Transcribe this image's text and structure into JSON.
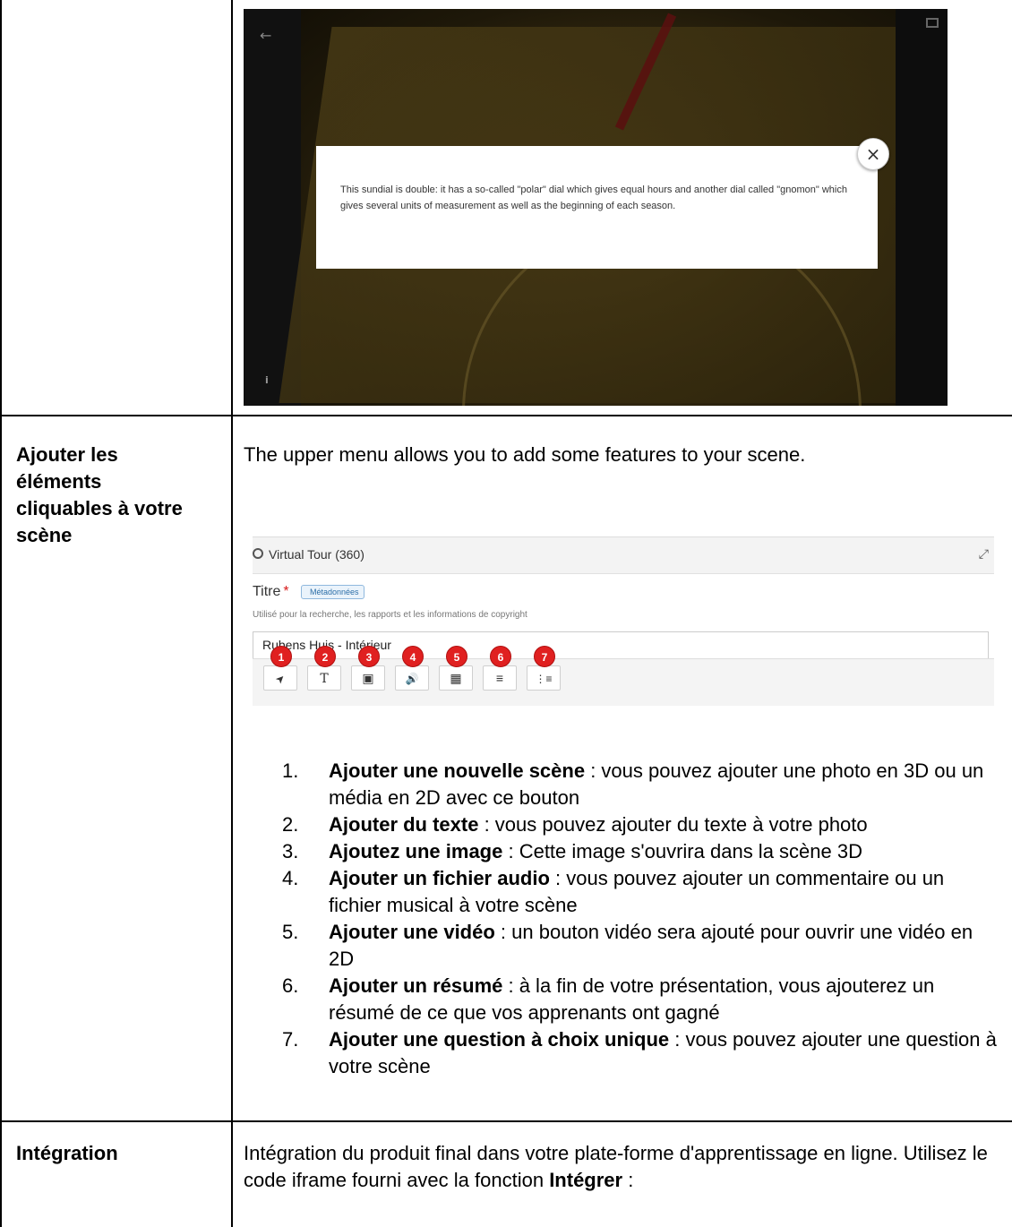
{
  "viewer": {
    "popup_text": "This sundial is double: it has a so-called \"polar\" dial which gives equal hours and another dial called \"gnomon\" which gives several units of measurement as well as the beginning of each season.",
    "close_glyph": "×",
    "back_glyph": "←",
    "info_glyph": "i"
  },
  "rows": [
    {
      "label": "Ajouter les éléments cliquables à votre scène",
      "label_lines": [
        "Ajouter les",
        "éléments",
        "cliquables à votre",
        "scène"
      ],
      "intro": "The upper menu allows you to add some features to your scene."
    },
    {
      "label": "Intégration",
      "text_prefix": "Intégration du produit final dans votre plate-forme d'apprentissage en ligne.  Utilisez le code iframe fourni avec la fonction ",
      "text_bold": "Intégrer",
      "text_suffix": " :"
    }
  ],
  "editor": {
    "header_title": "Virtual Tour (360)",
    "field_label": "Titre",
    "required_mark": "*",
    "meta_tag": "Métadonnées",
    "help_text": "Utilisé pour la recherche, les rapports et les informations de copyright",
    "input_value": "Rubens Huis - Intérieur",
    "toolbar": [
      {
        "badge": "1",
        "icon": "navigation-arrow-icon",
        "glyph": "➤"
      },
      {
        "badge": "2",
        "icon": "text-icon",
        "glyph": "T"
      },
      {
        "badge": "3",
        "icon": "image-icon",
        "glyph": "▣"
      },
      {
        "badge": "4",
        "icon": "audio-icon",
        "glyph": "🔊"
      },
      {
        "badge": "5",
        "icon": "video-icon",
        "glyph": "▦"
      },
      {
        "badge": "6",
        "icon": "summary-list-icon",
        "glyph": "≡"
      },
      {
        "badge": "7",
        "icon": "numbered-list-icon",
        "glyph": "⋮≡"
      }
    ]
  },
  "list": [
    {
      "n": "1.",
      "bold": "Ajouter une nouvelle scène",
      "rest": " : vous pouvez ajouter une photo en 3D ou un média en 2D avec ce bouton"
    },
    {
      "n": "2.",
      "bold": "Ajouter du texte",
      "rest": " : vous pouvez ajouter du texte à votre photo"
    },
    {
      "n": "3.",
      "bold": "Ajoutez une image",
      "rest": " : Cette image s'ouvrira dans la scène 3D"
    },
    {
      "n": "4.",
      "bold": "Ajouter un fichier audio",
      "rest": " : vous pouvez ajouter un commentaire ou un fichier musical à votre scène"
    },
    {
      "n": "5.",
      "bold": "Ajouter une vidéo",
      "rest": " : un bouton vidéo sera ajouté pour ouvrir une vidéo en 2D"
    },
    {
      "n": "6.",
      "bold": "Ajouter un résumé",
      "rest": " : à la fin de votre présentation, vous ajouterez un résumé de ce que vos apprenants ont gagné"
    },
    {
      "n": "7.",
      "bold": "Ajouter une question à choix unique",
      "rest": " : vous pouvez ajouter une question à votre scène"
    }
  ]
}
